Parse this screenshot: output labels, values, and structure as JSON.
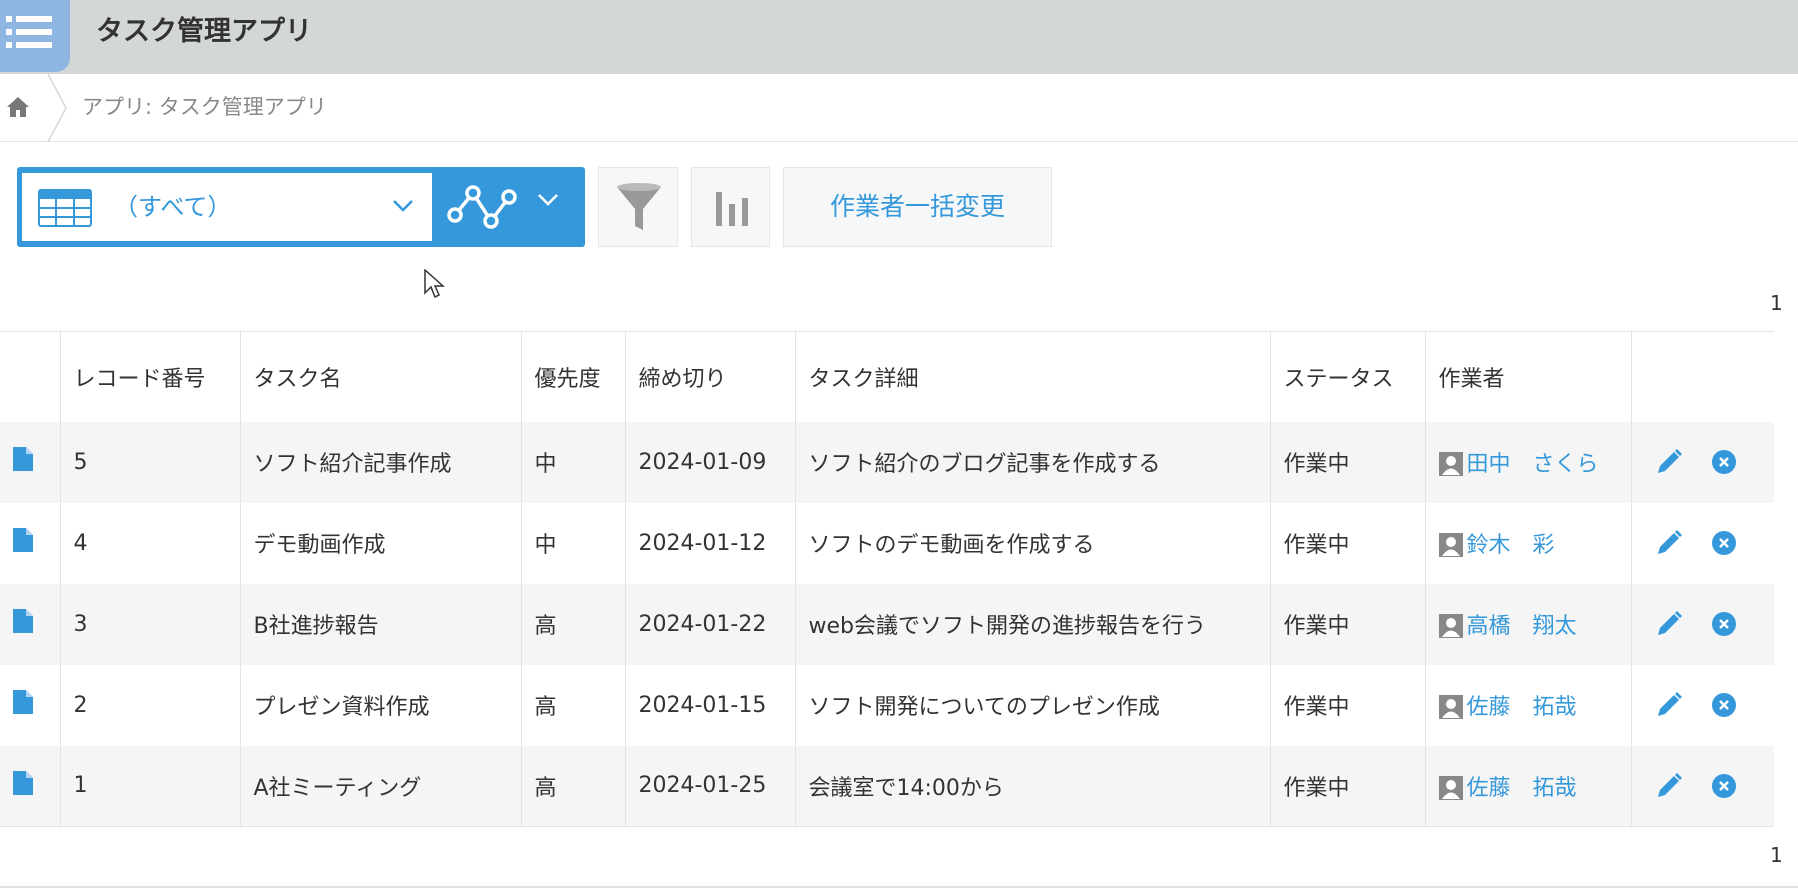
{
  "header": {
    "app_title": "タスク管理アプリ",
    "app_icon": "list-icon"
  },
  "breadcrumb": {
    "home_icon": "home-icon",
    "path": "アプリ: タスク管理アプリ"
  },
  "toolbar": {
    "view_selected": "（すべて）",
    "view_icon": "table-view-icon",
    "graph_icon": "line-graph-icon",
    "filter_icon": "funnel-icon",
    "graph_settings_icon": "bar-chart-icon",
    "bulk_change_label": "作業者一括変更"
  },
  "pagination": {
    "top": "1",
    "bottom": "1"
  },
  "table": {
    "columns": [
      "レコード番号",
      "タスク名",
      "優先度",
      "締め切り",
      "タスク詳細",
      "ステータス",
      "作業者"
    ],
    "rows": [
      {
        "id": "5",
        "name": "ソフト紹介記事作成",
        "priority": "中",
        "due": "2024-01-09",
        "detail": "ソフト紹介のブログ記事を作成する",
        "status": "作業中",
        "worker": "田中　さくら"
      },
      {
        "id": "4",
        "name": "デモ動画作成",
        "priority": "中",
        "due": "2024-01-12",
        "detail": "ソフトのデモ動画を作成する",
        "status": "作業中",
        "worker": "鈴木　彩"
      },
      {
        "id": "3",
        "name": "B社進捗報告",
        "priority": "高",
        "due": "2024-01-22",
        "detail": "web会議でソフト開発の進捗報告を行う",
        "status": "作業中",
        "worker": "高橋　翔太"
      },
      {
        "id": "2",
        "name": "プレゼン資料作成",
        "priority": "高",
        "due": "2024-01-15",
        "detail": "ソフト開発についてのプレゼン作成",
        "status": "作業中",
        "worker": "佐藤　拓哉"
      },
      {
        "id": "1",
        "name": "A社ミーティング",
        "priority": "高",
        "due": "2024-01-25",
        "detail": "会議室で14:00から",
        "status": "作業中",
        "worker": "佐藤　拓哉"
      }
    ]
  },
  "colors": {
    "accent": "#3498db",
    "header_bg": "#d4d7d8",
    "row_alt": "#f5f5f5"
  }
}
